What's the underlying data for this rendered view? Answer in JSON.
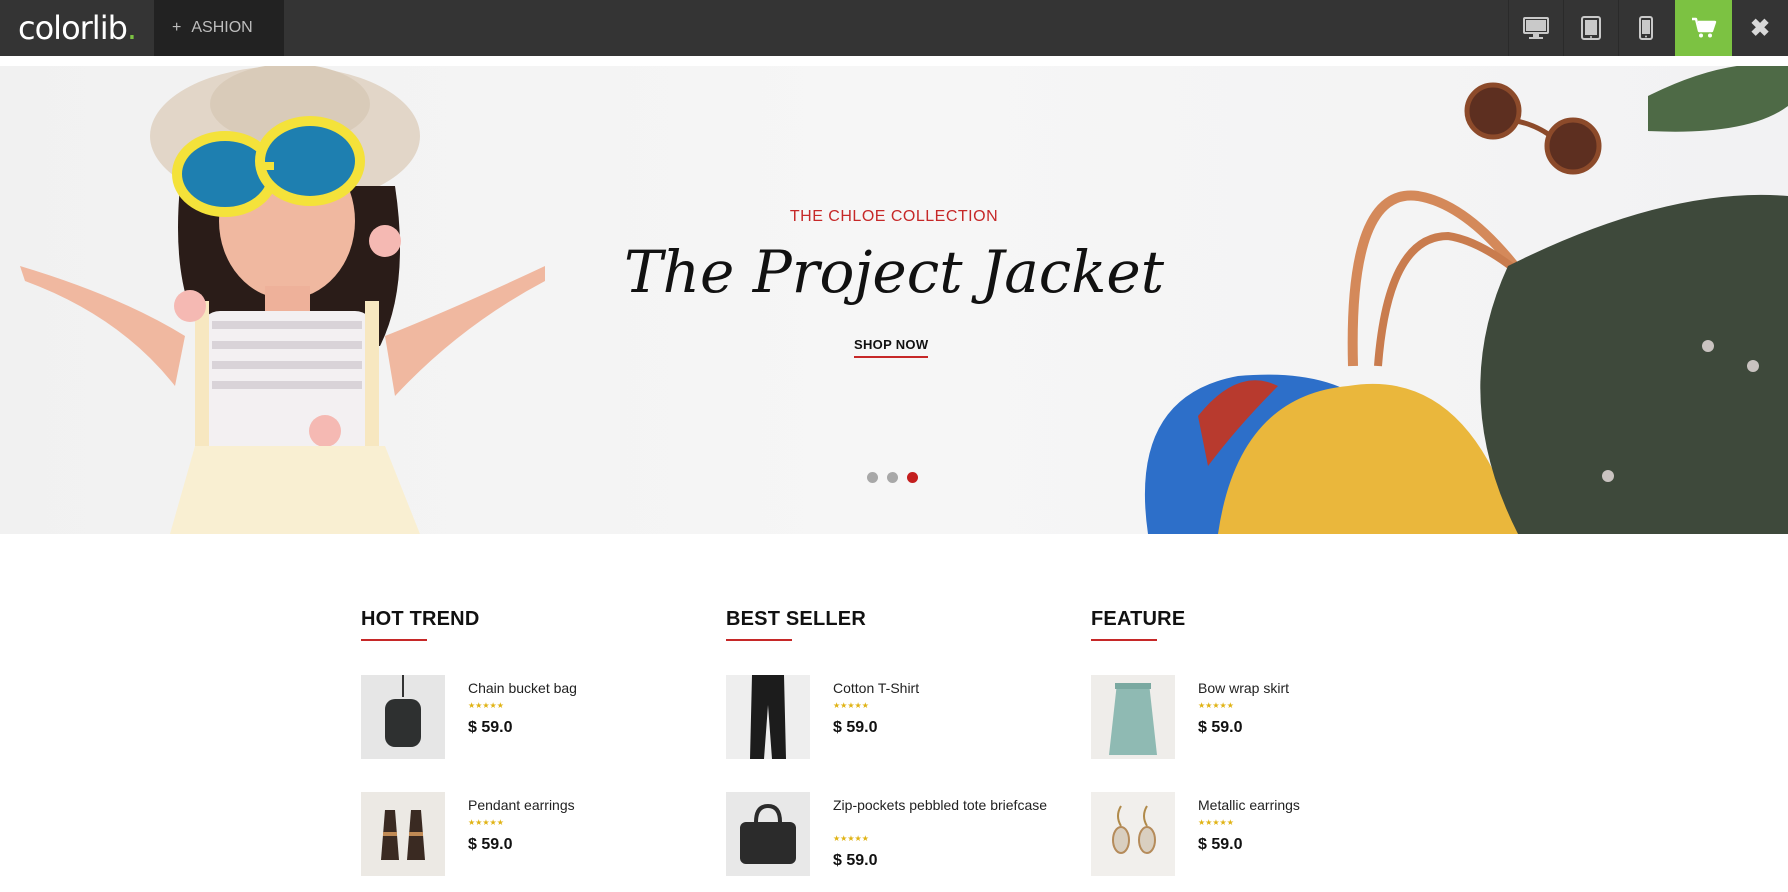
{
  "topbar": {
    "logo": {
      "text": "colorlib",
      "dot": "."
    },
    "theme_tab": {
      "plus": "+",
      "label": "ASHION"
    },
    "devices": [
      {
        "icon": "desktop-icon"
      },
      {
        "icon": "tablet-icon"
      },
      {
        "icon": "mobile-icon"
      }
    ],
    "cart_icon": "cart-icon",
    "close_icon": "close-icon",
    "close_glyph": "✖",
    "accent_color": "#7cc242"
  },
  "hero": {
    "eyebrow": "THE CHLOE COLLECTION",
    "title": "The Project Jacket",
    "cta": "SHOP NOW",
    "slides": 3,
    "active_slide": 3,
    "accent_color": "#c62828"
  },
  "sections": [
    {
      "title": "HOT TREND",
      "items": [
        {
          "name": "Chain bucket bag",
          "stars": "★★★★★",
          "price": "$ 59.0"
        },
        {
          "name": "Pendant earrings",
          "stars": "★★★★★",
          "price": "$ 59.0"
        }
      ]
    },
    {
      "title": "BEST SELLER",
      "items": [
        {
          "name": "Cotton T-Shirt",
          "stars": "★★★★★",
          "price": "$ 59.0"
        },
        {
          "name": "Zip-pockets pebbled tote briefcase",
          "stars": "★★★★★",
          "price": "$ 59.0"
        }
      ]
    },
    {
      "title": "FEATURE",
      "items": [
        {
          "name": "Bow wrap skirt",
          "stars": "★★★★★",
          "price": "$ 59.0"
        },
        {
          "name": "Metallic earrings",
          "stars": "★★★★★",
          "price": "$ 59.0"
        }
      ]
    }
  ]
}
